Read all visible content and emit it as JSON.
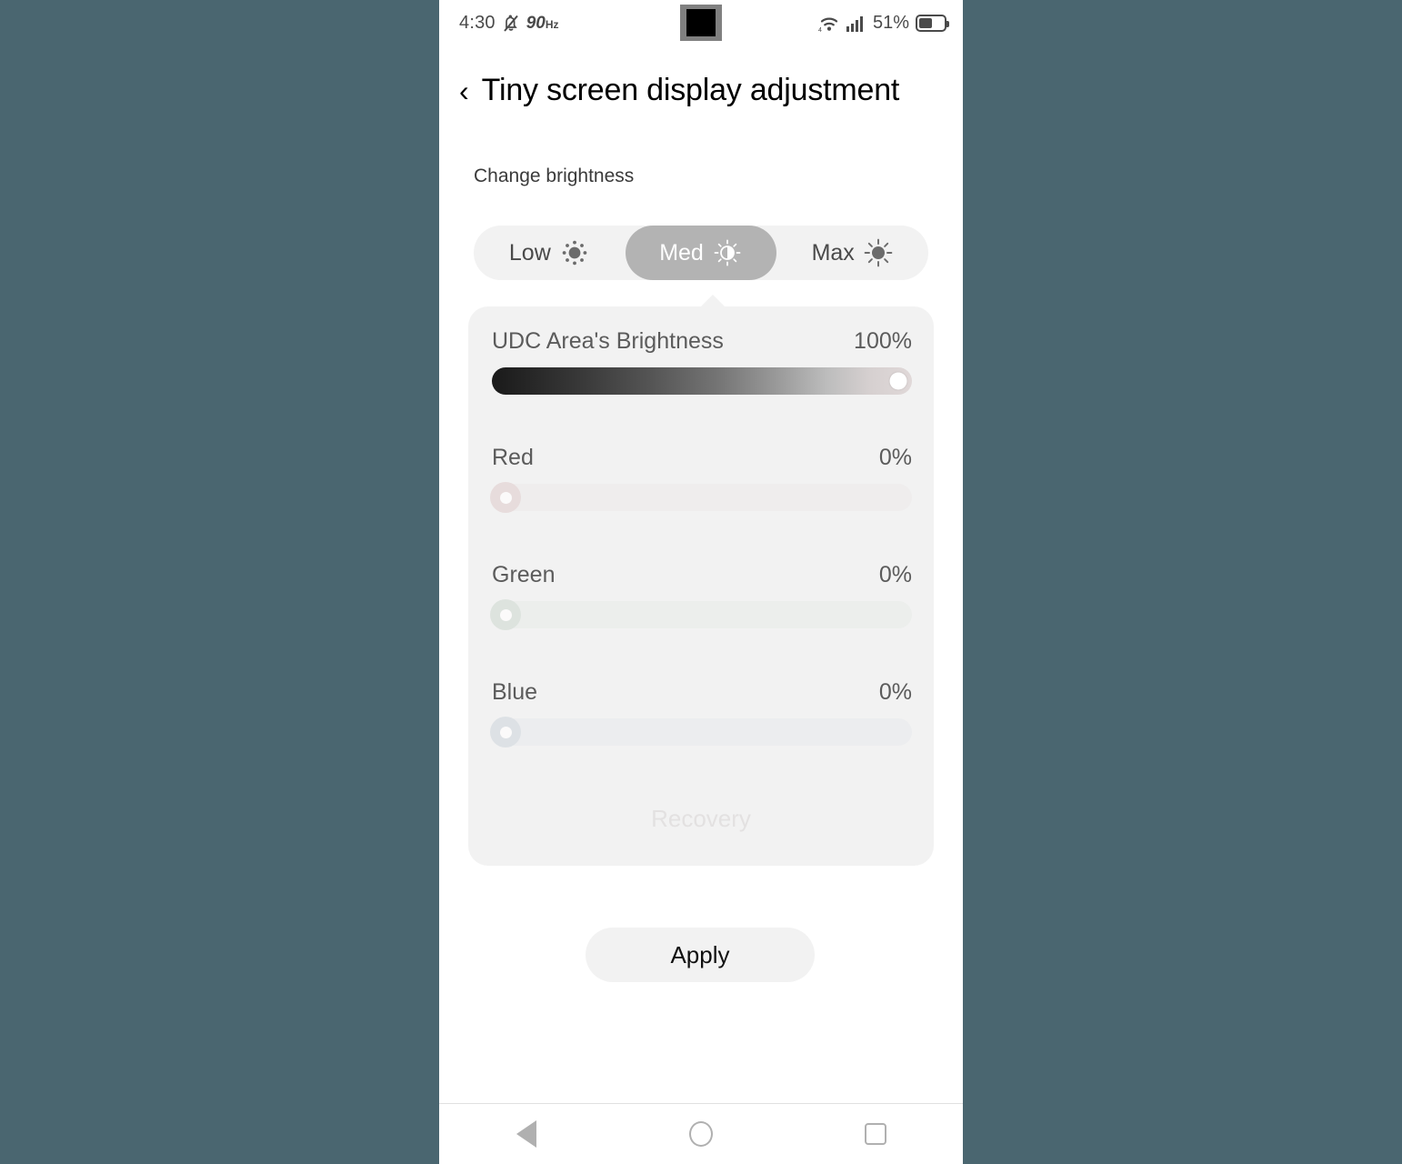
{
  "status_bar": {
    "clock": "4:30",
    "mute_icon": "bell-mute-icon",
    "refresh_rate": "90",
    "refresh_unit": "Hz",
    "wifi_icon": "wifi-4g-icon",
    "signal_icon": "signal-bars-icon",
    "battery_percent": "51%",
    "battery_icon": "battery-icon",
    "battery_level": 51
  },
  "header": {
    "back_icon": "chevron-left-icon",
    "title": "Tiny screen display adjustment"
  },
  "section": {
    "label": "Change brightness"
  },
  "brightness_modes": {
    "selected": "Med",
    "options": [
      {
        "label": "Low",
        "icon": "sun-low-icon",
        "active": false
      },
      {
        "label": "Med",
        "icon": "sun-half-icon",
        "active": true
      },
      {
        "label": "Max",
        "icon": "sun-max-icon",
        "active": false
      }
    ]
  },
  "sliders": [
    {
      "name": "UDC Area's Brightness",
      "value": "100%",
      "percent": 100,
      "key": "udc"
    },
    {
      "name": "Red",
      "value": "0%",
      "percent": 0,
      "key": "red"
    },
    {
      "name": "Green",
      "value": "0%",
      "percent": 0,
      "key": "green"
    },
    {
      "name": "Blue",
      "value": "0%",
      "percent": 0,
      "key": "blue"
    }
  ],
  "card": {
    "recovery_label": "Recovery"
  },
  "apply": {
    "label": "Apply"
  },
  "nav_bar": {
    "back": "nav-back-triangle-icon",
    "home": "nav-home-circle-icon",
    "recents": "nav-recents-square-icon"
  },
  "colors": {
    "page_background": "#4a6670",
    "screen_background": "#ffffff",
    "card_background": "#f2f2f2",
    "segment_track": "#f2f2f2",
    "segment_active": "#b3b3b3",
    "text_primary": "#000000",
    "text_secondary": "#5b5b5b",
    "recovery_disabled": "#e3e1e1",
    "nav_icon": "#b0b0b0"
  }
}
